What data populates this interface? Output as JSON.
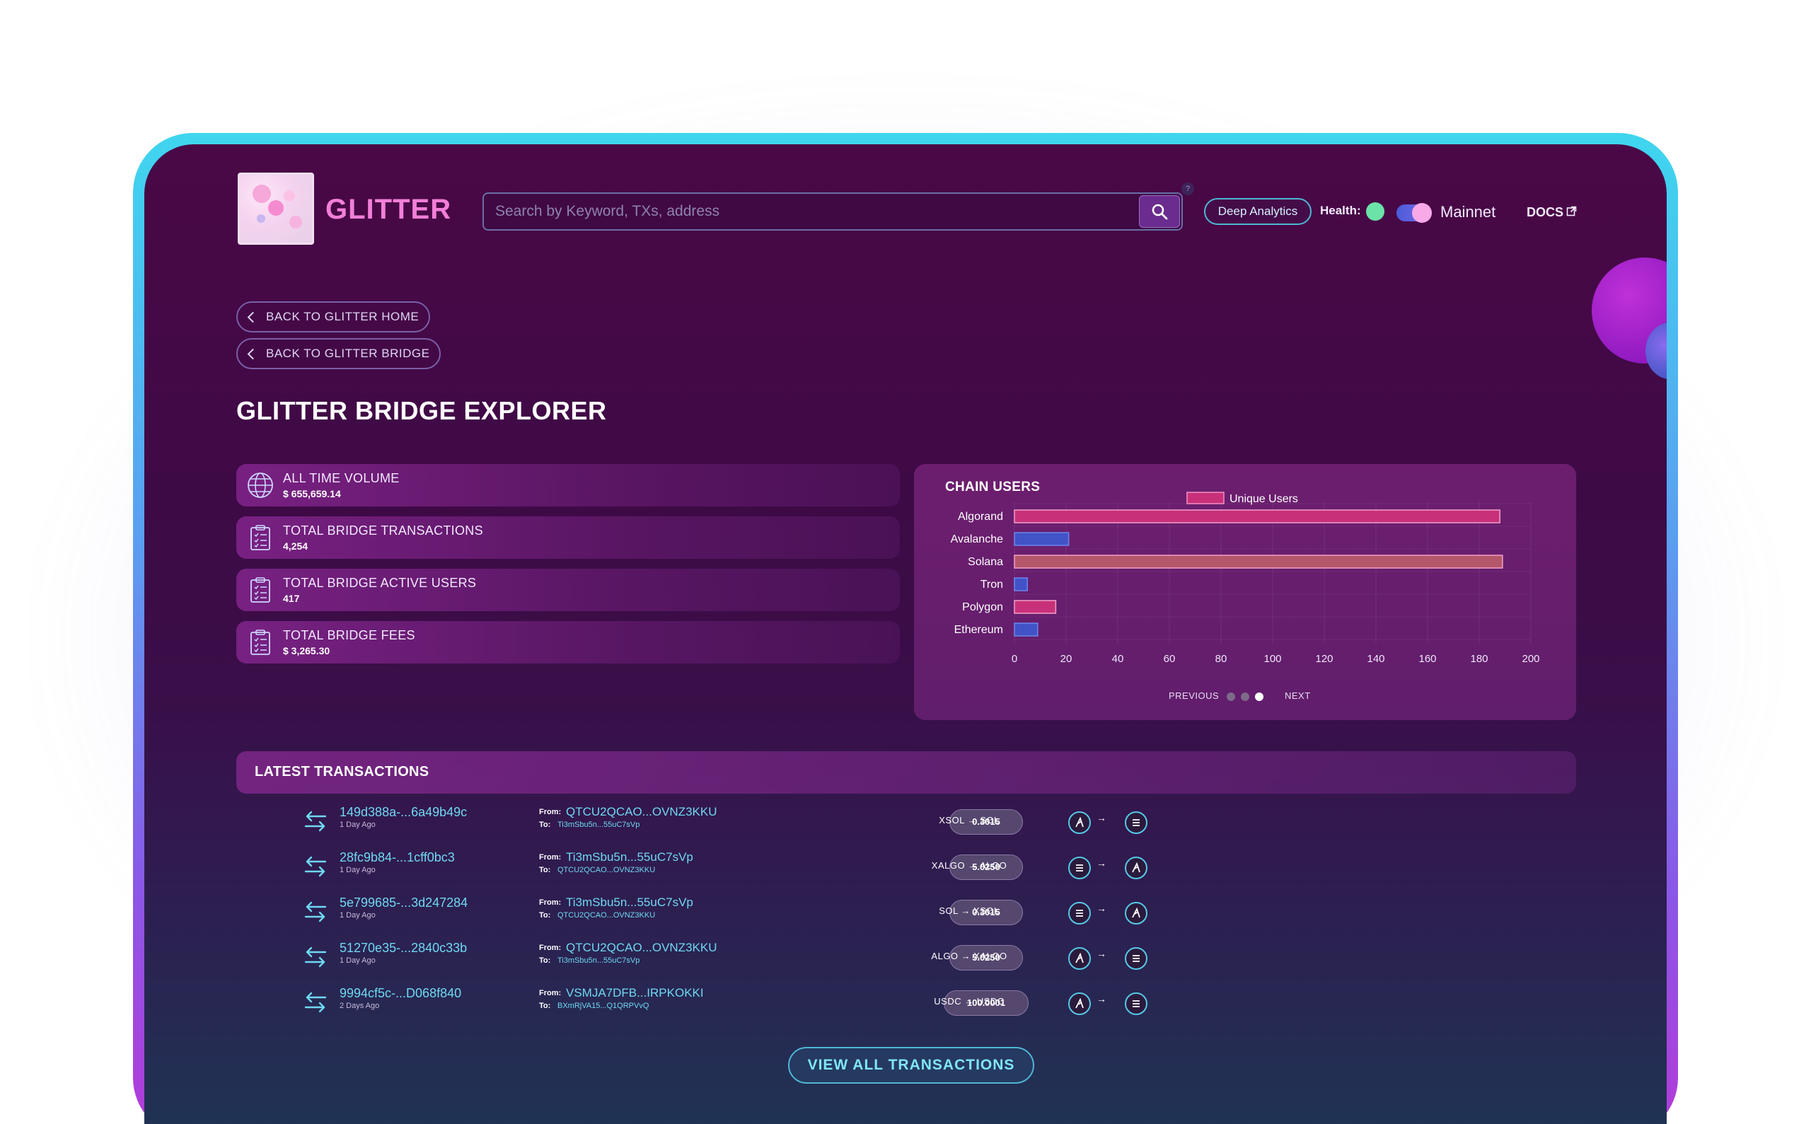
{
  "header": {
    "brand": "GLITTER",
    "search_placeholder": "Search by Keyword, TXs, address",
    "help_mark": "?",
    "deep_analytics_label": "Deep Analytics",
    "health_label": "Health:",
    "health_color": "#6be3a8",
    "network_label": "Mainnet",
    "docs_label": "DOCS"
  },
  "nav": {
    "back_home": "BACK TO GLITTER HOME",
    "back_bridge": "BACK TO GLITTER BRIDGE"
  },
  "page_title": "GLITTER BRIDGE EXPLORER",
  "stats": [
    {
      "label": "ALL TIME VOLUME",
      "value": "$ 655,659.14",
      "icon": "globe-icon"
    },
    {
      "label": "TOTAL BRIDGE TRANSACTIONS",
      "value": "4,254",
      "icon": "clipboard-icon"
    },
    {
      "label": "TOTAL BRIDGE ACTIVE USERS",
      "value": "417",
      "icon": "clipboard-icon"
    },
    {
      "label": "TOTAL BRIDGE FEES",
      "value": "$ 3,265.30",
      "icon": "clipboard-icon"
    }
  ],
  "chart_panel": {
    "title": "CHAIN USERS",
    "prev_label": "PREVIOUS",
    "next_label": "NEXT",
    "active_page": 3,
    "page_count": 3
  },
  "chart_data": {
    "type": "bar",
    "orientation": "horizontal",
    "title": "CHAIN USERS",
    "categories": [
      "Algorand",
      "Avalanche",
      "Solana",
      "Tron",
      "Polygon",
      "Ethereum"
    ],
    "series": [
      {
        "name": "Unique Users",
        "values": [
          188,
          21,
          189,
          5,
          16,
          9
        ]
      }
    ],
    "bar_colors": [
      "#c8317a",
      "#4153c7",
      "#b5576a",
      "#4153c7",
      "#c8317a",
      "#4153c7"
    ],
    "legend_color": "#c8317a",
    "xlim": [
      0,
      200
    ],
    "x_ticks": [
      "0",
      "20",
      "40",
      "60",
      "80",
      "100",
      "120",
      "140",
      "160",
      "180",
      "200"
    ],
    "legend_position": "top",
    "grid": true
  },
  "transactions": {
    "title": "LATEST TRANSACTIONS",
    "from_label": "From:",
    "to_label": "To:",
    "rows": [
      {
        "hash": "149d388a-...6a49b49c",
        "age": "1 Day Ago",
        "from": "QTCU2QCAO...OVNZ3KKU",
        "to": "Ti3mSbu5n...55uC7sVp",
        "amount": "0.3015",
        "pair_from": "XSOL",
        "pair_to": "SOL",
        "chain_from": "algorand-icon",
        "chain_to": "solana-icon"
      },
      {
        "hash": "28fc9b84-...1cff0bc3",
        "age": "1 Day Ago",
        "from": "Ti3mSbu5n...55uC7sVp",
        "to": "QTCU2QCAO...OVNZ3KKU",
        "amount": "5.0250",
        "pair_from": "XALGO",
        "pair_to": "ALGO",
        "chain_from": "solana-icon",
        "chain_to": "algorand-icon"
      },
      {
        "hash": "5e799685-...3d247284",
        "age": "1 Day Ago",
        "from": "Ti3mSbu5n...55uC7sVp",
        "to": "QTCU2QCAO...OVNZ3KKU",
        "amount": "0.3015",
        "pair_from": "SOL",
        "pair_to": "XSOL",
        "chain_from": "solana-icon",
        "chain_to": "algorand-icon"
      },
      {
        "hash": "51270e35-...2840c33b",
        "age": "1 Day Ago",
        "from": "QTCU2QCAO...OVNZ3KKU",
        "to": "Ti3mSbu5n...55uC7sVp",
        "amount": "5.0250",
        "pair_from": "ALGO",
        "pair_to": "XALGO",
        "chain_from": "algorand-icon",
        "chain_to": "solana-icon"
      },
      {
        "hash": "9994cf5c-...D068f840",
        "age": "2 Days Ago",
        "from": "VSMJA7DFB...IRPKOKKI",
        "to": "BXmRjVA15...Q1QRPVvQ",
        "amount": "100.0001",
        "pair_from": "USDC",
        "pair_to": "USDC",
        "chain_from": "algorand-icon",
        "chain_to": "solana-icon"
      }
    ],
    "view_all_label": "VIEW ALL TRANSACTIONS"
  },
  "colors": {
    "accent_cyan": "#6fd8f2",
    "brand_pink": "#f27fd8",
    "frame_top": "#3fd6ef",
    "frame_bottom": "#b33ad8"
  }
}
